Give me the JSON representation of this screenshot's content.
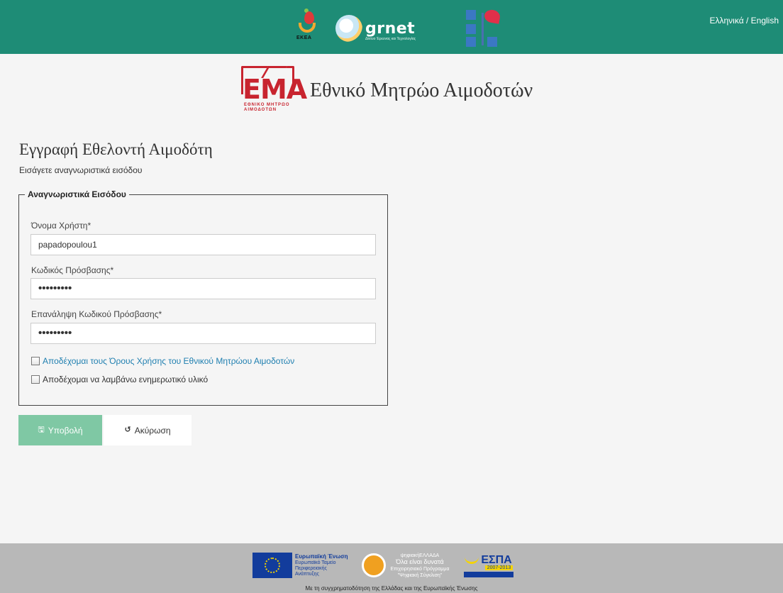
{
  "header": {
    "logos": {
      "ekea_text": "ΕΚΕΑ",
      "grnet_name": "grnet",
      "grnet_tagline": "Δίκτυο Έρευνας και Τεχνολογίας"
    },
    "language_switch": "Ελληνικά / English",
    "colors": {
      "bar": "#1e8c76"
    }
  },
  "brand": {
    "logo_letters": "ΕΜΑ",
    "logo_small_line1": "ΕΘΝΙΚΟ ΜΗΤΡΩΟ",
    "logo_small_line2": "ΑΙΜΟΔΟΤΩΝ",
    "title": "Εθνικό Μητρώο Αιμοδοτών",
    "color": "#c8242f"
  },
  "page": {
    "title": "Εγγραφή Εθελοντή Αιμοδότη",
    "subtitle": "Εισάγετε αναγνωριστικά εισόδου"
  },
  "form": {
    "legend": "Αναγνωριστικά Εισόδου",
    "username": {
      "label": "Όνομα Χρήστη*",
      "value": "papadopoulou1"
    },
    "password": {
      "label": "Κωδικός Πρόσβασης*",
      "value": "•••••••••"
    },
    "password_repeat": {
      "label": "Επανάληψη Κωδικού Πρόσβασης*",
      "value": "•••••••••"
    },
    "terms_checkbox": {
      "label": "Αποδέχομαι τους Όρους Χρήσης του Εθνικού Μητρώου Αιμοδοτών",
      "checked": false
    },
    "newsletter_checkbox": {
      "label": "Αποδέχομαι να λαμβάνω ενημερωτικό υλικό",
      "checked": false
    }
  },
  "actions": {
    "submit_label": "Υποβολή",
    "submit_icon": "floppy-disk-icon",
    "cancel_label": "Ακύρωση",
    "cancel_icon": "undo-icon",
    "submit_color": "#7fc8a4"
  },
  "footer": {
    "eu_line1": "Ευρωπαϊκή Ένωση",
    "eu_line2": "Ευρωπαϊκό Ταμείο",
    "eu_line3": "Περιφερειακής",
    "eu_line4": "Ανάπτυξης",
    "digital_line1": "ψηφιακήΕΛΛΑΔΑ",
    "digital_line2": "Όλα είναι δυνατά",
    "digital_line3": "Επιχειρησιακό Πρόγραμμα",
    "digital_line4": "\"Ψηφιακή Σύγκλιση\"",
    "espa_title": "ΕΣΠΑ",
    "espa_years": "2007-2013",
    "caption": "Με τη συγχρηματοδότηση της Ελλάδας και της Ευρωπαϊκής Ένωσης"
  }
}
